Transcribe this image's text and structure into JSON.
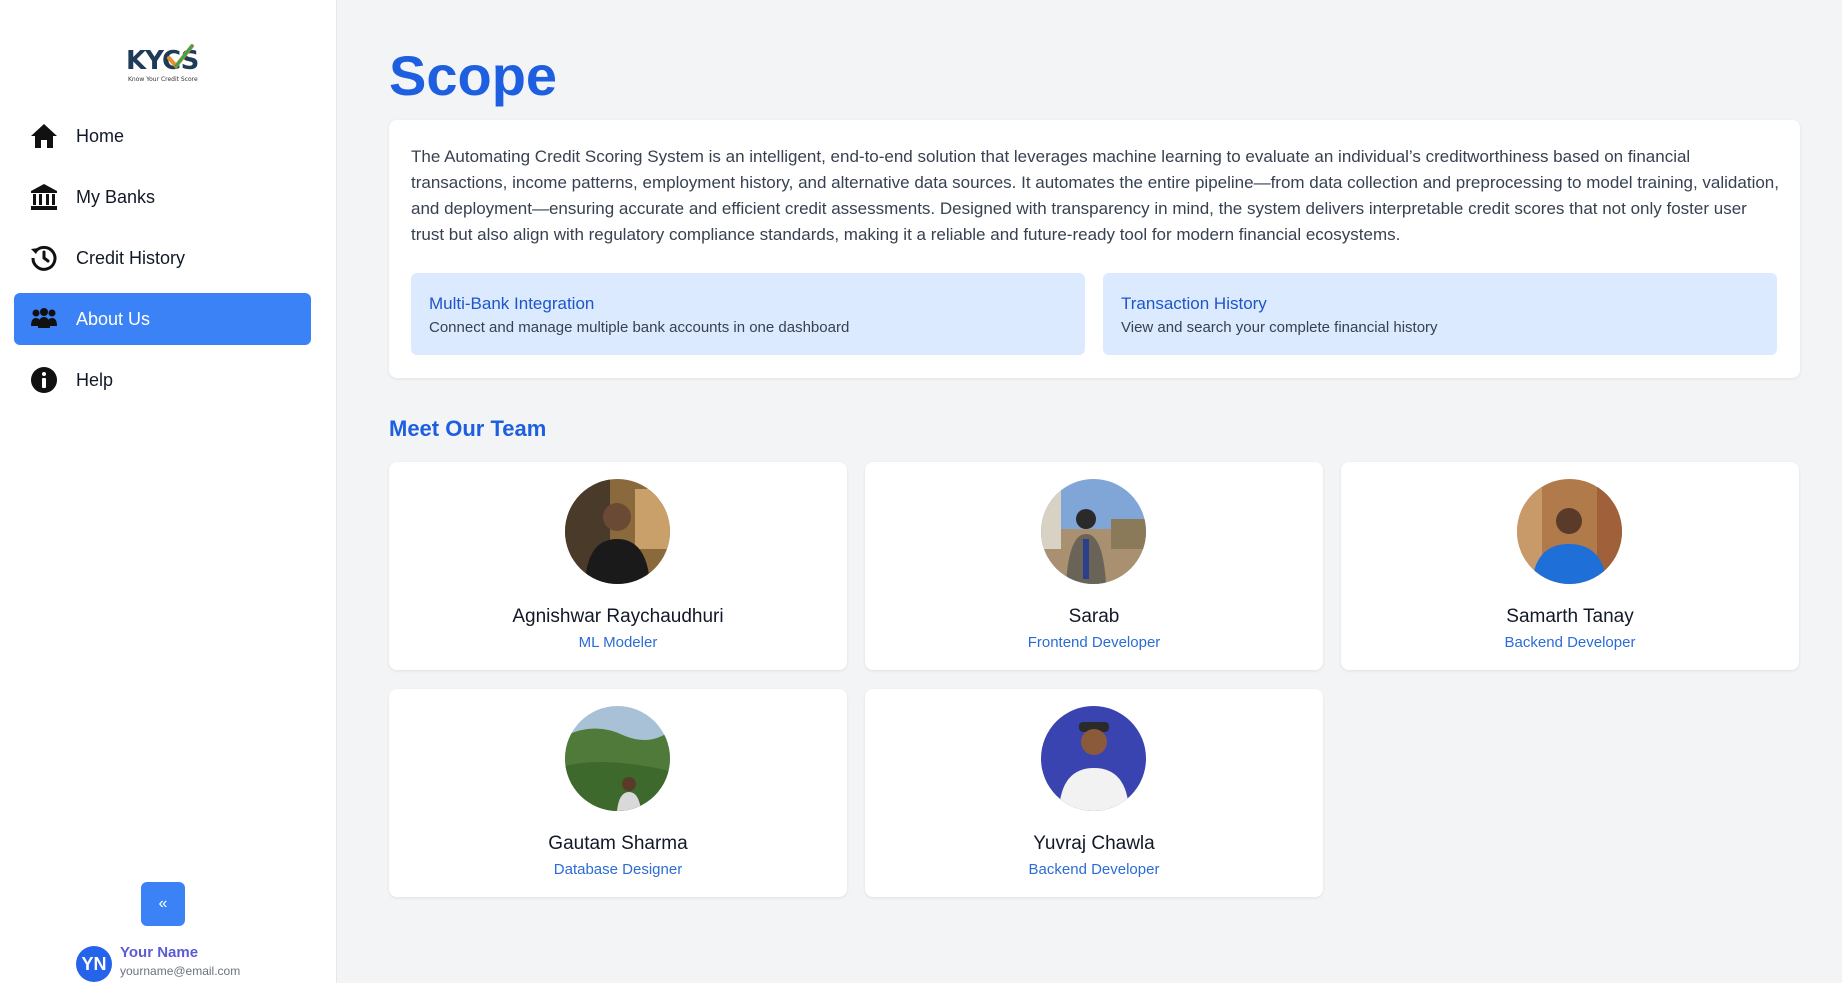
{
  "brand": {
    "logo_text": "KYCS",
    "logo_tagline": "Know Your Credit Score"
  },
  "sidebar": {
    "items": [
      {
        "label": "Home",
        "icon": "home-icon",
        "active": false
      },
      {
        "label": "My Banks",
        "icon": "bank-icon",
        "active": false
      },
      {
        "label": "Credit History",
        "icon": "history-icon",
        "active": false
      },
      {
        "label": "About Us",
        "icon": "people-icon",
        "active": true
      },
      {
        "label": "Help",
        "icon": "info-icon",
        "active": false
      }
    ],
    "collapse_label": "«",
    "user": {
      "initials": "YN",
      "name": "Your Name",
      "email": "yourname@email.com"
    }
  },
  "main": {
    "title": "Scope",
    "scope_text": "The Automating Credit Scoring System is an intelligent, end-to-end solution that leverages machine learning to evaluate an individual’s creditworthiness based on financial transactions, income patterns, employment history, and alternative data sources. It automates the entire pipeline—from data collection and preprocessing to model training, validation, and deployment—ensuring accurate and efficient credit assessments. Designed with transparency in mind, the system delivers interpretable credit scores that not only foster user trust but also align with regulatory compliance standards, making it a reliable and future-ready tool for modern financial ecosystems.",
    "features": [
      {
        "title": "Multi-Bank Integration",
        "desc": "Connect and manage multiple bank accounts in one dashboard"
      },
      {
        "title": "Transaction History",
        "desc": "View and search your complete financial history"
      }
    ],
    "team_title": "Meet Our Team",
    "team": [
      {
        "name": "Agnishwar Raychaudhuri",
        "role": "ML Modeler"
      },
      {
        "name": "Sarab",
        "role": "Frontend Developer"
      },
      {
        "name": "Samarth Tanay",
        "role": "Backend Developer"
      },
      {
        "name": "Gautam Sharma",
        "role": "Database Designer"
      },
      {
        "name": "Yuvraj Chawla",
        "role": "Backend Developer"
      }
    ]
  },
  "colors": {
    "accent": "#3b82f6",
    "title_blue": "#1d5fe0",
    "feature_bg": "#dbeafe",
    "role_blue": "#2b6cd6"
  }
}
